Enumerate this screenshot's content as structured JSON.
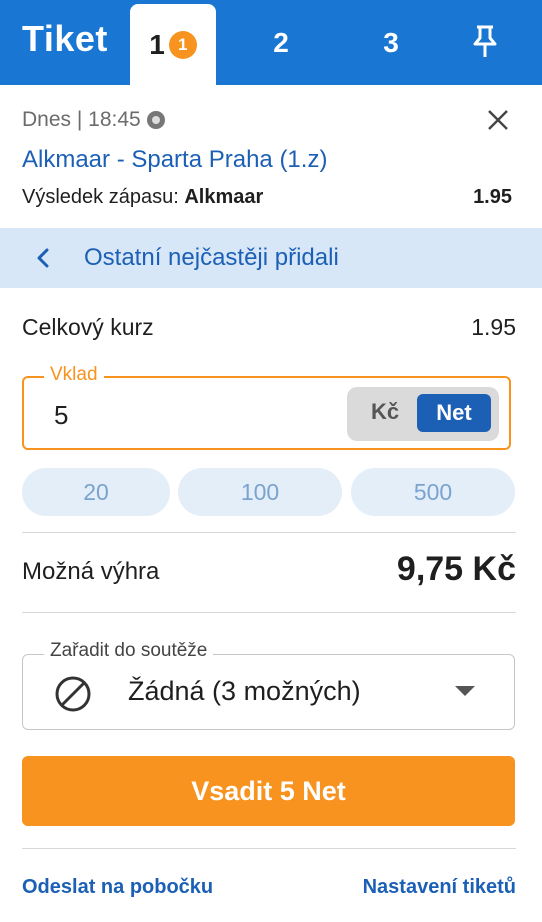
{
  "header": {
    "brand": "Tiket",
    "tabs": [
      {
        "label": "1",
        "badge": "1",
        "active": true
      },
      {
        "label": "2",
        "active": false
      },
      {
        "label": "3",
        "active": false
      }
    ],
    "pin_icon": "pin-icon"
  },
  "bet": {
    "time": "Dnes | 18:45",
    "sport_icon": "soccer-ball-icon",
    "match": "Alkmaar - Sparta Praha (1.z)",
    "market_label": "Výsledek zápasu:",
    "selection": "Alkmaar",
    "odds": "1.95"
  },
  "popular": {
    "label": "Ostatní nejčastěji přidali"
  },
  "total": {
    "label": "Celkový kurz",
    "value": "1.95"
  },
  "stake": {
    "legend": "Vklad",
    "value": "5",
    "currency_options": [
      "Kč",
      "Net"
    ],
    "selected_currency": "Net",
    "quick_amounts": [
      "20",
      "100",
      "500"
    ]
  },
  "win": {
    "label": "Možná výhra",
    "value": "9,75 Kč"
  },
  "competition": {
    "legend": "Zařadit do soutěže",
    "value": "Žádná (3 možných)"
  },
  "actions": {
    "bet_label": "Vsadit 5 Net"
  },
  "footer": {
    "send_branch": "Odeslat na pobočku",
    "settings": "Nastavení tiketů"
  },
  "colors": {
    "brand_blue": "#1976d2",
    "accent_orange": "#f7931e",
    "link_blue": "#1c60b6",
    "popular_bg": "#d7e7f8"
  }
}
